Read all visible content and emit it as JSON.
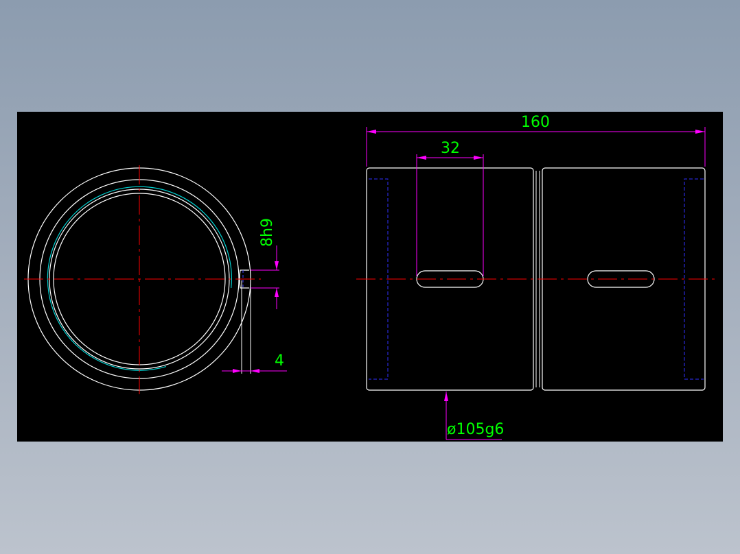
{
  "drawing": {
    "background_color": "#000000",
    "colors": {
      "outline": "#ffffff",
      "centerline": "#ff0000",
      "dimension": "#ff00ff",
      "dimension_text": "#00ff00",
      "hidden": "#0000ff",
      "thread": "#00ffff"
    },
    "dimensions": {
      "overall_length": "160",
      "slot_length": "32",
      "key_width": "8h9",
      "key_depth": "4",
      "diameter": "ø105g6"
    }
  }
}
